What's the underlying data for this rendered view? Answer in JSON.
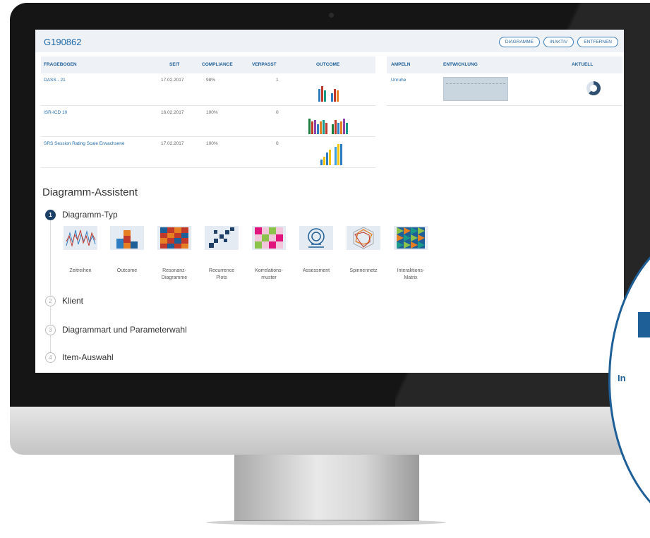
{
  "patient_id": "G190862",
  "buttons": [
    "DIAGRAMME",
    "INAKTIV",
    "ENTFERNEN"
  ],
  "table": {
    "headers": [
      "FRAGEBOGEN",
      "SEIT",
      "COMPLIANCE",
      "VERPASST",
      "OUTCOME"
    ],
    "rows": [
      {
        "name": "DASS - 21",
        "seit": "17.02.2017",
        "compliance": "98%",
        "verpasst": "1"
      },
      {
        "name": "ISR-ICD 10",
        "seit": "16.02.2017",
        "compliance": "100%",
        "verpasst": "0"
      },
      {
        "name": "SRS Session Rating Scale Erwachsene",
        "seit": "17.02.2017",
        "compliance": "100%",
        "verpasst": "0"
      }
    ]
  },
  "ampel_table": {
    "headers": [
      "AMPELN",
      "ENTWICKLUNG",
      "AKTUELL"
    ],
    "row": {
      "name": "Unruhe",
      "donut_label": "62%"
    }
  },
  "assistant": {
    "title": "Diagramm-Assistent",
    "steps": [
      {
        "num": "1",
        "label": "Diagramm-Typ"
      },
      {
        "num": "2",
        "label": "Klient"
      },
      {
        "num": "3",
        "label": "Diagrammart und Parameterwahl"
      },
      {
        "num": "4",
        "label": "Item-Auswahl"
      }
    ],
    "types": [
      {
        "l1": "Zeitreihen",
        "l2": ""
      },
      {
        "l1": "Outcome",
        "l2": ""
      },
      {
        "l1": "Resonanz-",
        "l2": "Diagramme"
      },
      {
        "l1": "Recurrence",
        "l2": "Plots"
      },
      {
        "l1": "Korrelations-",
        "l2": "muster"
      },
      {
        "l1": "Assessment",
        "l2": ""
      },
      {
        "l1": "Spinnennetz",
        "l2": ""
      },
      {
        "l1": "Interaktions-",
        "l2": "Matrix"
      }
    ]
  },
  "callout_text": "In",
  "colors": {
    "accent": "#1f6aa9",
    "header_bg": "#eef1f6",
    "step_active": "#1c3f66"
  }
}
